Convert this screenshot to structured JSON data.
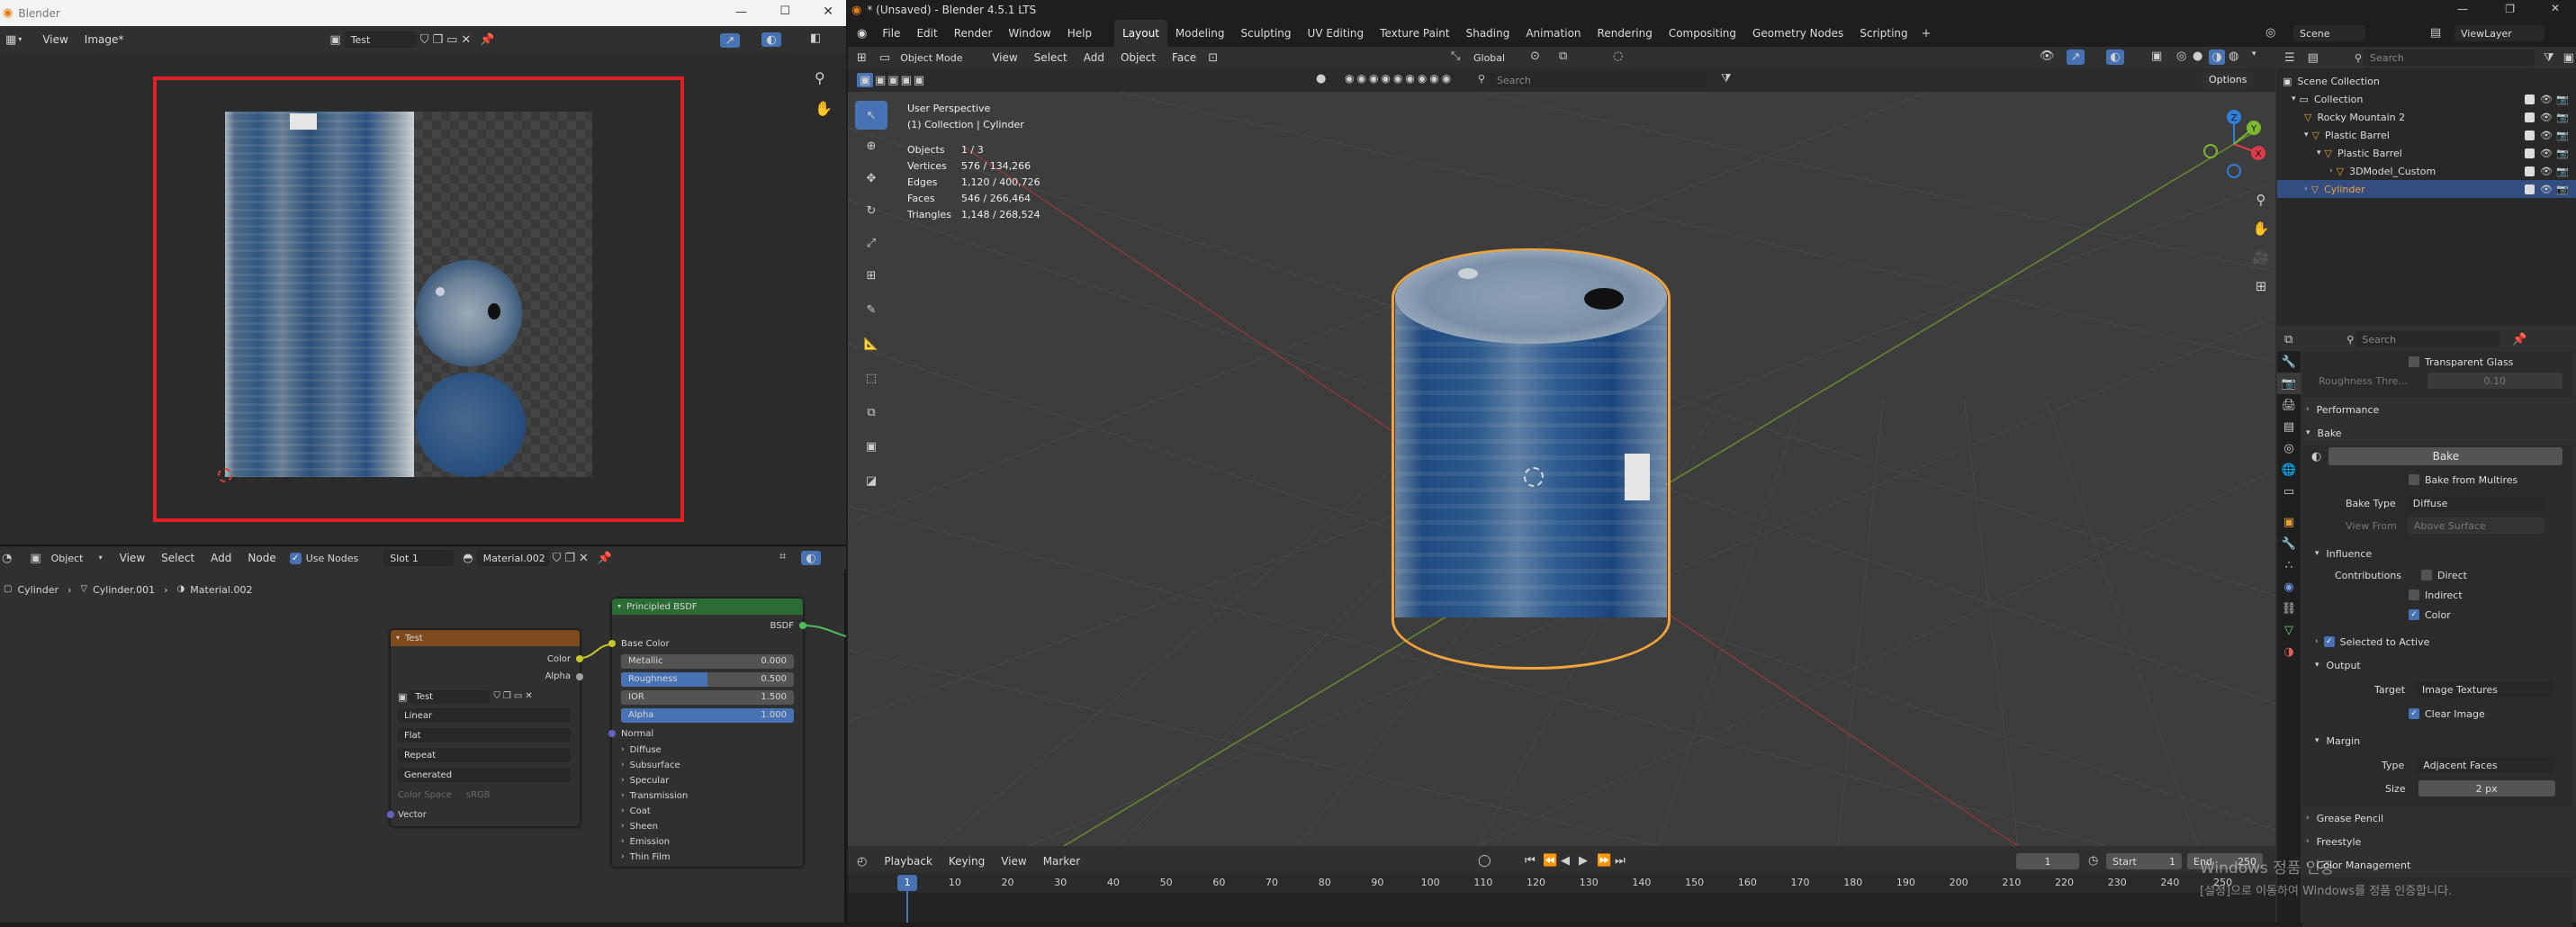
{
  "left_window": {
    "title": "Blender",
    "menus": [
      "View",
      "Image*"
    ],
    "image_name": "Test",
    "node_editor": {
      "mode": "Object",
      "menus": [
        "View",
        "Select",
        "Add",
        "Node"
      ],
      "use_nodes_label": "Use Nodes",
      "slot": "Slot 1",
      "material": "Material.002",
      "breadcrumbs": [
        "Cylinder",
        "Cylinder.001",
        "Material.002"
      ],
      "image_node": {
        "title": "Test",
        "out_color": "Color",
        "out_alpha": "Alpha",
        "image": "Test",
        "interpolation": "Linear",
        "projection": "Flat",
        "extension": "Repeat",
        "source": "Generated",
        "color_space_label": "Color Space",
        "color_space_value": "sRGB",
        "in_vector": "Vector"
      },
      "bsdf_node": {
        "title": "Principled BSDF",
        "output": "BSDF",
        "base_color": "Base Color",
        "metallic_label": "Metallic",
        "metallic_value": "0.000",
        "metallic_fill": 0,
        "roughness_label": "Roughness",
        "roughness_value": "0.500",
        "roughness_fill": 0.5,
        "ior_label": "IOR",
        "ior_value": "1.500",
        "ior_fill": 0,
        "alpha_label": "Alpha",
        "alpha_value": "1.000",
        "alpha_fill": 1,
        "normal": "Normal",
        "panels": [
          "Diffuse",
          "Subsurface",
          "Specular",
          "Transmission",
          "Coat",
          "Sheen",
          "Emission",
          "Thin Film"
        ]
      }
    }
  },
  "main_window": {
    "title": "* (Unsaved) - Blender 4.5.1 LTS",
    "menus": [
      "File",
      "Edit",
      "Render",
      "Window",
      "Help"
    ],
    "workspaces": [
      "Layout",
      "Modeling",
      "Sculpting",
      "UV Editing",
      "Texture Paint",
      "Shading",
      "Animation",
      "Rendering",
      "Compositing",
      "Geometry Nodes",
      "Scripting"
    ],
    "active_workspace": "Layout",
    "scene": "Scene",
    "view_layer": "ViewLayer"
  },
  "viewport": {
    "mode": "Object Mode",
    "menus": [
      "View",
      "Select",
      "Add",
      "Object",
      "Face"
    ],
    "orientation": "Global",
    "search_placeholder": "Search",
    "options_label": "Options",
    "perspective": "User Perspective",
    "collection_info": "(1) Collection | Cylinder",
    "stats": [
      {
        "k": "Objects",
        "v": "1 / 3"
      },
      {
        "k": "Vertices",
        "v": "576 / 134,266"
      },
      {
        "k": "Edges",
        "v": "1,120 / 400,726"
      },
      {
        "k": "Faces",
        "v": "546 / 266,464"
      },
      {
        "k": "Triangles",
        "v": "1,148 / 268,524"
      }
    ],
    "gizmo": {
      "x": "X",
      "y": "Y",
      "z": "Z"
    }
  },
  "outliner": {
    "search_placeholder": "Search",
    "items": [
      "Scene Collection",
      "Collection",
      "Rocky Mountain 2",
      "Plastic Barrel",
      "Plastic Barrel",
      "3DModel_Custom",
      "Cylinder"
    ]
  },
  "properties": {
    "search_placeholder": "Search",
    "transparent_glass": "Transparent Glass",
    "roughness_threshold_label": "Roughness Thre...",
    "roughness_threshold_value": "0.10",
    "performance": "Performance",
    "bake_panel": "Bake",
    "bake_button": "Bake",
    "bake_from_multires": "Bake from Multires",
    "bake_type_label": "Bake Type",
    "bake_type_value": "Diffuse",
    "view_from_label": "View From",
    "view_from_value": "Above Surface",
    "influence": "Influence",
    "contributions_label": "Contributions",
    "direct": "Direct",
    "indirect": "Indirect",
    "color": "Color",
    "selected_to_active": "Selected to Active",
    "output": "Output",
    "target_label": "Target",
    "target_value": "Image Textures",
    "clear_image": "Clear Image",
    "margin": "Margin",
    "margin_type_label": "Type",
    "margin_type_value": "Adjacent Faces",
    "size_label": "Size",
    "size_value": "2 px",
    "grease_pencil": "Grease Pencil",
    "freestyle": "Freestyle",
    "color_management": "Color Management"
  },
  "timeline": {
    "menus": [
      "Playback",
      "Keying",
      "View",
      "Marker"
    ],
    "current_frame": "1",
    "start_label": "Start",
    "start_value": "1",
    "end_label": "End",
    "end_value": "250",
    "ticks": [
      "1",
      "10",
      "20",
      "30",
      "40",
      "50",
      "60",
      "70",
      "80",
      "90",
      "100",
      "110",
      "120",
      "130",
      "140",
      "150",
      "160",
      "170",
      "180",
      "190",
      "200",
      "210",
      "220",
      "230",
      "240",
      "250"
    ]
  },
  "watermark": {
    "line1": "Windows 정품 인증",
    "line2": "[설정]으로 이동하여 Windows를 정품 인증합니다."
  }
}
